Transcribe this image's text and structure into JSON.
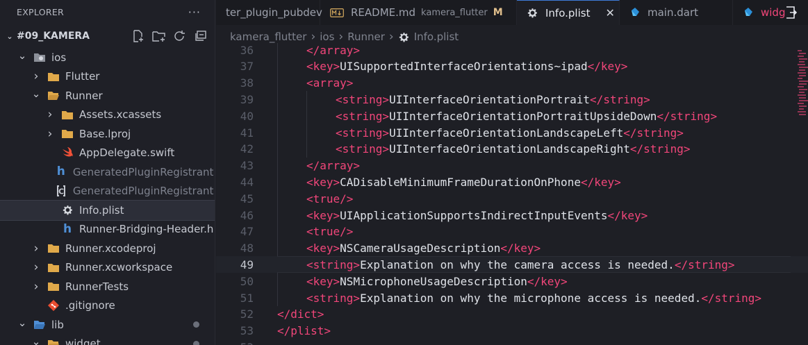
{
  "explorer": {
    "title": "EXPLORER",
    "more": "···",
    "project": "#09_KAMERA",
    "tree": [
      {
        "label": "ios",
        "depth": 1,
        "chev": "open",
        "icon": "apple-folder",
        "dim": false,
        "selected": false,
        "dot": false
      },
      {
        "label": "Flutter",
        "depth": 2,
        "chev": "closed",
        "icon": "folder",
        "dim": false,
        "selected": false,
        "dot": false
      },
      {
        "label": "Runner",
        "depth": 2,
        "chev": "open",
        "icon": "folder-open",
        "dim": false,
        "selected": false,
        "dot": false
      },
      {
        "label": "Assets.xcassets",
        "depth": 3,
        "chev": "closed",
        "icon": "folder",
        "dim": false,
        "selected": false,
        "dot": false
      },
      {
        "label": "Base.lproj",
        "depth": 3,
        "chev": "closed",
        "icon": "folder",
        "dim": false,
        "selected": false,
        "dot": false
      },
      {
        "label": "AppDelegate.swift",
        "depth": 3,
        "chev": "none",
        "icon": "swift",
        "dim": false,
        "selected": false,
        "dot": false
      },
      {
        "label": "GeneratedPluginRegistrant.h",
        "depth": 3,
        "chev": "none",
        "icon": "h-file",
        "dim": true,
        "selected": false,
        "dot": false
      },
      {
        "label": "GeneratedPluginRegistrant.m",
        "depth": 3,
        "chev": "none",
        "icon": "c-file",
        "dim": true,
        "selected": false,
        "dot": false
      },
      {
        "label": "Info.plist",
        "depth": 3,
        "chev": "none",
        "icon": "gear",
        "dim": false,
        "selected": true,
        "dot": false
      },
      {
        "label": "Runner-Bridging-Header.h",
        "depth": 3,
        "chev": "none",
        "icon": "h-file",
        "dim": false,
        "selected": false,
        "dot": false
      },
      {
        "label": "Runner.xcodeproj",
        "depth": 2,
        "chev": "closed",
        "icon": "folder",
        "dim": false,
        "selected": false,
        "dot": false
      },
      {
        "label": "Runner.xcworkspace",
        "depth": 2,
        "chev": "closed",
        "icon": "folder",
        "dim": false,
        "selected": false,
        "dot": false
      },
      {
        "label": "RunnerTests",
        "depth": 2,
        "chev": "closed",
        "icon": "folder",
        "dim": false,
        "selected": false,
        "dot": false
      },
      {
        "label": ".gitignore",
        "depth": 2,
        "chev": "none",
        "icon": "git",
        "dim": false,
        "selected": false,
        "dot": false
      },
      {
        "label": "lib",
        "depth": 1,
        "chev": "open",
        "icon": "folder-open-blue",
        "dim": false,
        "selected": false,
        "dot": true
      },
      {
        "label": "widget",
        "depth": 2,
        "chev": "open",
        "icon": "folder-open",
        "dim": false,
        "selected": false,
        "dot": true
      }
    ]
  },
  "tabs": [
    {
      "label": "ter_plugin_pubdev",
      "sub": "",
      "mod": "",
      "icon": "",
      "active": false,
      "close": false
    },
    {
      "label": "README.md",
      "sub": "kamera_flutter",
      "mod": "M",
      "icon": "markdown",
      "active": false,
      "close": false
    },
    {
      "label": "Info.plist",
      "sub": "",
      "mod": "",
      "icon": "gear",
      "active": true,
      "close": true
    },
    {
      "label": "main.dart",
      "sub": "",
      "mod": "",
      "icon": "dart",
      "active": false,
      "close": false
    },
    {
      "label": "widg",
      "sub": "",
      "mod": "",
      "icon": "dart",
      "active": false,
      "close": false
    }
  ],
  "tab_close": "✕",
  "breadcrumb": [
    "kamera_flutter",
    "ios",
    "Runner",
    "Info.plist"
  ],
  "editor": {
    "current_line": 49,
    "lines": [
      {
        "n": "36",
        "indent": 1,
        "parts": [
          [
            "tag",
            "</array>"
          ]
        ]
      },
      {
        "n": "37",
        "indent": 1,
        "parts": [
          [
            "tag",
            "<key>"
          ],
          [
            "txt",
            "UISupportedInterfaceOrientations~ipad"
          ],
          [
            "tag",
            "</key>"
          ]
        ]
      },
      {
        "n": "38",
        "indent": 1,
        "parts": [
          [
            "tag",
            "<array>"
          ]
        ]
      },
      {
        "n": "39",
        "indent": 2,
        "parts": [
          [
            "tag",
            "<string>"
          ],
          [
            "txt",
            "UIInterfaceOrientationPortrait"
          ],
          [
            "tag",
            "</string>"
          ]
        ]
      },
      {
        "n": "40",
        "indent": 2,
        "parts": [
          [
            "tag",
            "<string>"
          ],
          [
            "txt",
            "UIInterfaceOrientationPortraitUpsideDown"
          ],
          [
            "tag",
            "</string>"
          ]
        ]
      },
      {
        "n": "41",
        "indent": 2,
        "parts": [
          [
            "tag",
            "<string>"
          ],
          [
            "txt",
            "UIInterfaceOrientationLandscapeLeft"
          ],
          [
            "tag",
            "</string>"
          ]
        ]
      },
      {
        "n": "42",
        "indent": 2,
        "parts": [
          [
            "tag",
            "<string>"
          ],
          [
            "txt",
            "UIInterfaceOrientationLandscapeRight"
          ],
          [
            "tag",
            "</string>"
          ]
        ]
      },
      {
        "n": "43",
        "indent": 1,
        "parts": [
          [
            "tag",
            "</array>"
          ]
        ]
      },
      {
        "n": "44",
        "indent": 1,
        "parts": [
          [
            "tag",
            "<key>"
          ],
          [
            "txt",
            "CADisableMinimumFrameDurationOnPhone"
          ],
          [
            "tag",
            "</key>"
          ]
        ]
      },
      {
        "n": "45",
        "indent": 1,
        "parts": [
          [
            "tag",
            "<true/>"
          ]
        ]
      },
      {
        "n": "46",
        "indent": 1,
        "parts": [
          [
            "tag",
            "<key>"
          ],
          [
            "txt",
            "UIApplicationSupportsIndirectInputEvents"
          ],
          [
            "tag",
            "</key>"
          ]
        ]
      },
      {
        "n": "47",
        "indent": 1,
        "parts": [
          [
            "tag",
            "<true/>"
          ]
        ]
      },
      {
        "n": "48",
        "indent": 1,
        "parts": [
          [
            "tag",
            "<key>"
          ],
          [
            "txt",
            "NSCameraUsageDescription"
          ],
          [
            "tag",
            "</key>"
          ]
        ]
      },
      {
        "n": "49",
        "indent": 1,
        "parts": [
          [
            "tag",
            "<string>"
          ],
          [
            "txt",
            "Explanation on why the camera access is needed."
          ],
          [
            "tag",
            "</string>"
          ]
        ]
      },
      {
        "n": "50",
        "indent": 1,
        "parts": [
          [
            "tag",
            "<key>"
          ],
          [
            "txt",
            "NSMicrophoneUsageDescription"
          ],
          [
            "tag",
            "</key>"
          ]
        ]
      },
      {
        "n": "51",
        "indent": 1,
        "parts": [
          [
            "tag",
            "<string>"
          ],
          [
            "txt",
            "Explanation on why the microphone access is needed."
          ],
          [
            "tag",
            "</string>"
          ]
        ]
      },
      {
        "n": "52",
        "indent": 0,
        "parts": [
          [
            "tag",
            "</dict>"
          ]
        ]
      },
      {
        "n": "53",
        "indent": 0,
        "parts": [
          [
            "tag",
            "</plist>"
          ]
        ]
      },
      {
        "n": "53",
        "indent": 0,
        "parts": []
      }
    ]
  },
  "colors": {
    "tag": "#f2467a",
    "text": "#dfe2e8",
    "folder": "#e0a94a",
    "accent": "#3e7bd8",
    "modified": "#e2c08d"
  }
}
